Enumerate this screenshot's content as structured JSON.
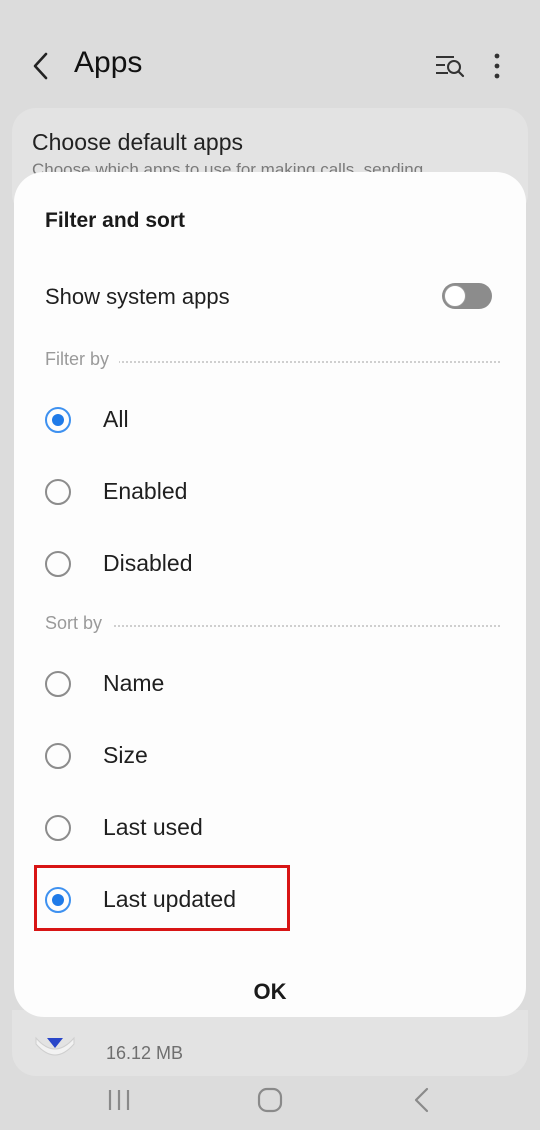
{
  "app_bar": {
    "title": "Apps",
    "back_icon": "chevron-left-icon",
    "filter_icon": "filter-search-icon",
    "more_icon": "more-vertical-icon"
  },
  "background": {
    "card_title": "Choose default apps",
    "card_subtitle": "Choose which apps to use for making calls, sending",
    "row_size": "16.12 MB"
  },
  "dialog": {
    "title": "Filter and sort",
    "toggle": {
      "label": "Show system apps",
      "on": false
    },
    "filter_by": {
      "header": "Filter by",
      "options": [
        {
          "label": "All",
          "checked": true
        },
        {
          "label": "Enabled",
          "checked": false
        },
        {
          "label": "Disabled",
          "checked": false
        }
      ]
    },
    "sort_by": {
      "header": "Sort by",
      "options": [
        {
          "label": "Name",
          "checked": false
        },
        {
          "label": "Size",
          "checked": false
        },
        {
          "label": "Last used",
          "checked": false
        },
        {
          "label": "Last updated",
          "checked": true
        }
      ]
    },
    "ok_label": "OK"
  },
  "colors": {
    "accent": "#1f7ae8",
    "highlight": "#d81515",
    "dialog_bg": "#fdfdfd",
    "scrim_bg": "#dcdcdc"
  }
}
